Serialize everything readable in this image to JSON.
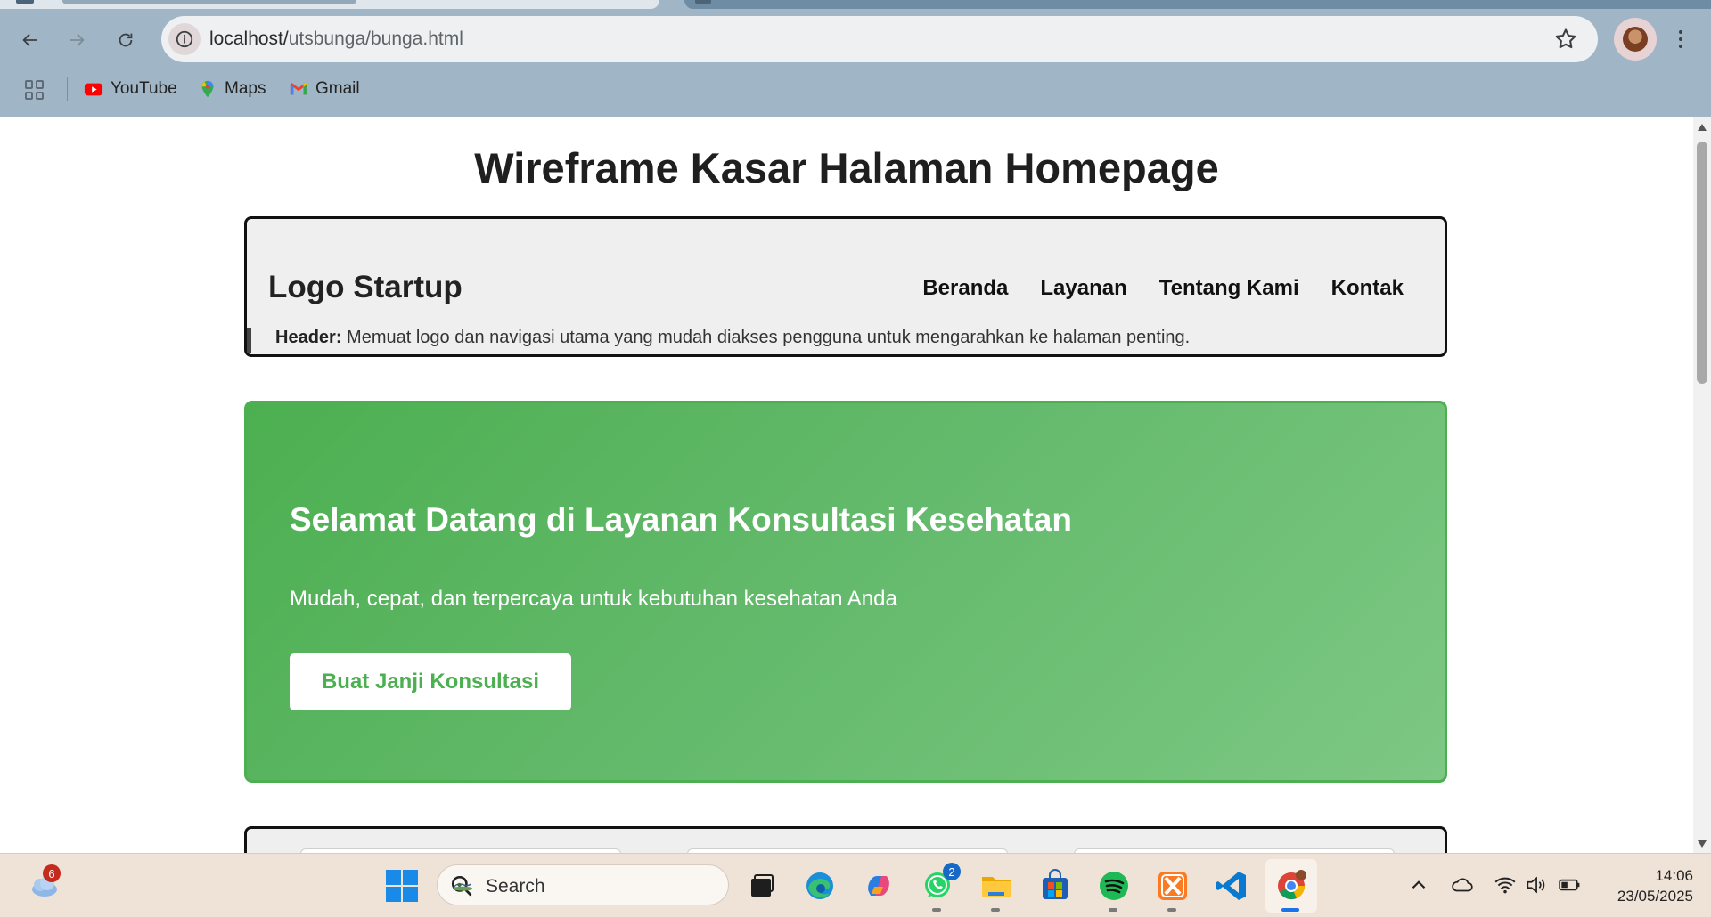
{
  "browser": {
    "url_host": "localhost/",
    "url_path": "utsbunga/bunga.html",
    "bookmarks": [
      {
        "label": "YouTube",
        "icon": "youtube-icon"
      },
      {
        "label": "Maps",
        "icon": "maps-icon"
      },
      {
        "label": "Gmail",
        "icon": "gmail-icon"
      }
    ]
  },
  "page": {
    "title": "Wireframe Kasar Halaman Homepage",
    "header": {
      "logo": "Logo Startup",
      "nav": [
        "Beranda",
        "Layanan",
        "Tentang Kami",
        "Kontak"
      ],
      "note_label": "Header:",
      "note_text": " Memuat logo dan navigasi utama yang mudah diakses pengguna untuk mengarahkan ke halaman penting."
    },
    "hero": {
      "title": "Selamat Datang di Layanan Konsultasi Kesehatan",
      "subtitle": "Mudah, cepat, dan terpercaya untuk kebutuhan kesehatan Anda",
      "cta": "Buat Janji Konsultasi"
    }
  },
  "taskbar": {
    "weather_badge": "6",
    "search_placeholder": "Search",
    "whatsapp_badge": "2",
    "time": "14:06",
    "date": "23/05/2025"
  },
  "colors": {
    "accent_green": "#4caf50",
    "chrome_bg": "#a0b6c6",
    "taskbar_bg": "#efe3d7"
  }
}
